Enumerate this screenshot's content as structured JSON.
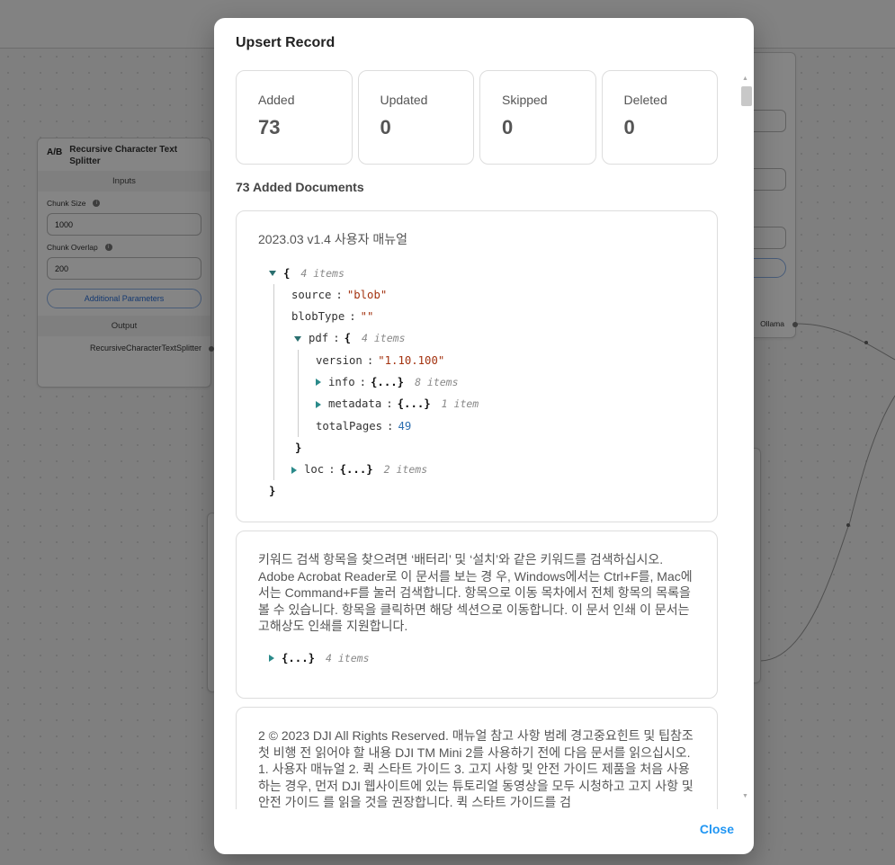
{
  "background": {
    "splitter_node": {
      "icon": "A/B",
      "title": "Recursive Character Text Splitter",
      "inputs_label": "Inputs",
      "chunk_size_label": "Chunk Size",
      "chunk_size_value": "1000",
      "chunk_overlap_label": "Chunk Overlap",
      "chunk_overlap_value": "200",
      "additional_params_label": "Additional Parameters",
      "output_label": "Output",
      "output_value": "RecursiveCharacterTextSplitter"
    },
    "right_node": {
      "output_label": "Ollama"
    }
  },
  "modal": {
    "title": "Upsert Record",
    "stats": [
      {
        "label": "Added",
        "value": "73"
      },
      {
        "label": "Updated",
        "value": "0"
      },
      {
        "label": "Skipped",
        "value": "0"
      },
      {
        "label": "Deleted",
        "value": "0"
      }
    ],
    "docs_count_label": "73 Added Documents",
    "documents": [
      {
        "text": "2023.03 v1.4 사용자 매뉴얼",
        "json": {
          "root_brace": "{",
          "root_count": "4 items",
          "source_key": "source",
          "source_val": "\"blob\"",
          "blobType_key": "blobType",
          "blobType_val": "\"\"",
          "pdf_key": "pdf",
          "pdf_count": "4 items",
          "version_key": "version",
          "version_val": "\"1.10.100\"",
          "info_key": "info",
          "info_collapsed": "{...}",
          "info_count": "8 items",
          "metadata_key": "metadata",
          "metadata_collapsed": "{...}",
          "metadata_count": "1 item",
          "totalPages_key": "totalPages",
          "totalPages_val": "49",
          "loc_key": "loc",
          "loc_collapsed": "{...}",
          "loc_count": "2 items"
        }
      },
      {
        "text": "키워드 검색 항목을 찾으려면 ‘배터리’ 및 ‘설치’와 같은 키워드를 검색하십시오. Adobe Acrobat Reader로 이 문서를 보는 경 우, Windows에서는 Ctrl+F를, Mac에서는 Command+F를 눌러 검색합니다. 항목으로 이동 목차에서 전체 항목의 목록을 볼 수 있습니다. 항목을 클릭하면 해당 섹션으로 이동합니다. 이 문서 인쇄 이 문서는 고해상도 인쇄를 지원합니다.",
        "json_collapsed": "{...}",
        "json_count": "4 items"
      },
      {
        "text": "2 © 2023 DJI All Rights Reserved. 매뉴얼 참고 사항 범례 경고중요힌트 및 팁참조 첫 비행 전 읽어야 할 내용 DJI TM Mini 2를 사용하기 전에 다음 문서를 읽으십시오. 1. 사용자 매뉴얼 2. 퀵 스타트 가이드 3. 고지 사항 및 안전 가이드 제품을 처음 사용하는 경우, 먼저 DJI 웹사이트에 있는 튜토리얼 동영상을 모두 시청하고 고지 사항 및 안전 가이드 를 읽을 것을 권장합니다. 퀵 스타트 가이드를 검"
      }
    ],
    "close_label": "Close"
  }
}
